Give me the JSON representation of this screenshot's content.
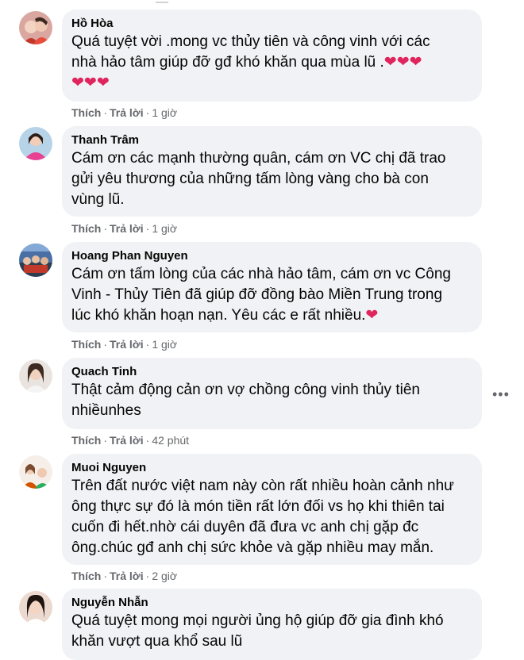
{
  "actions": {
    "like": "Thích",
    "reply": "Trả lời"
  },
  "comments": [
    {
      "author": "Hồ Hòa",
      "lines": [
        "Quá tuyệt vời .mong vc thủy tiên và công vinh với các",
        "nhà hảo tâm giúp đỡ gđ khó khăn qua mùa lũ ."
      ],
      "hearts_inline": "❤❤❤",
      "hearts_line": "❤❤❤",
      "time": "1 giờ"
    },
    {
      "author": "Thanh Trâm",
      "lines": [
        "Cám ơn các mạnh thường quân, cám ơn VC chị đã trao",
        "gửi yêu thương của những tấm lòng vàng cho bà con",
        "vùng lũ."
      ],
      "time": "1 giờ"
    },
    {
      "author": "Hoang Phan Nguyen",
      "lines": [
        "Cám ơn tấm lòng của các nhà hảo tâm, cám ơn vc Công",
        "Vinh - Thủy Tiên đã giúp đỡ đồng bào Miền Trung trong",
        "lúc khó khăn hoạn nạn. Yêu các e rất nhiều."
      ],
      "hearts_inline": "❤",
      "time": "1 giờ"
    },
    {
      "author": "Quach Tinh",
      "lines": [
        "Thật cảm động cản ơn vợ chồng công vinh thủy tiên",
        "nhiềunhes"
      ],
      "time": "42 phút",
      "more": "•••"
    },
    {
      "author": "Muoi Nguyen",
      "lines": [
        "Trên đất nước việt nam này còn rất nhiều hoàn cảnh như",
        "ông thực sự đó là món tiền rất lớn đối vs họ khi thiên tai",
        "cuốn đi hết.nhờ cái duyên đã đưa vc anh chị gặp đc",
        "ông.chúc gđ anh chị sức khỏe và gặp nhiều may mắn."
      ],
      "time": "2 giờ"
    },
    {
      "author": "Nguyễn Nhẫn",
      "lines": [
        "Quá tuyệt mong mọi người ủng hộ giúp đỡ gia đình khó",
        "khăn vượt qua khổ sau lũ"
      ]
    }
  ]
}
